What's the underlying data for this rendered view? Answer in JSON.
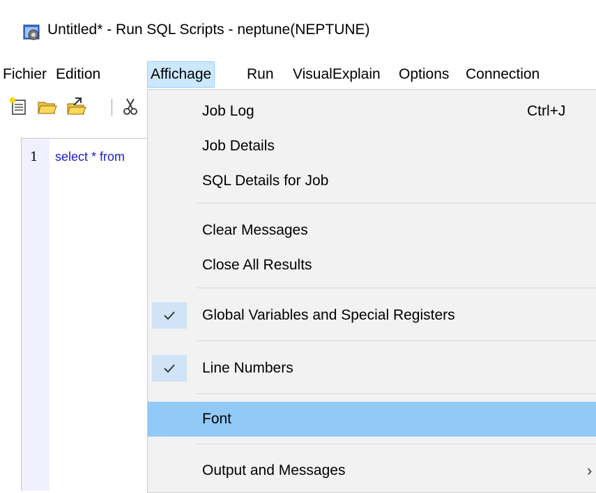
{
  "window": {
    "title": "Untitled* - Run SQL Scripts - neptune(NEPTUNE)",
    "icon": "run-sql-app-icon"
  },
  "menubar": {
    "items": [
      {
        "label": "Fichier"
      },
      {
        "label": "Edition"
      },
      {
        "label": "Affichage",
        "active": true
      },
      {
        "label": "Run"
      },
      {
        "label": "VisualExplain"
      },
      {
        "label": "Options"
      },
      {
        "label": "Connection"
      }
    ]
  },
  "toolbar": {
    "icons": [
      "new-file-icon",
      "open-folder-icon",
      "open-script-icon",
      "cut-icon"
    ]
  },
  "editor": {
    "line_number": "1",
    "code": "select * from"
  },
  "dropdown": {
    "items": [
      {
        "label": "Job Log",
        "shortcut": "Ctrl+J"
      },
      {
        "label": "Job Details",
        "shortcut": ""
      },
      {
        "label": "SQL Details for Job",
        "shortcut": ""
      },
      {
        "label": "Clear Messages",
        "shortcut": ""
      },
      {
        "label": "Close All Results",
        "shortcut": ""
      },
      {
        "label": "Global Variables and Special Registers",
        "checked": true
      },
      {
        "label": "Line Numbers",
        "checked": true
      },
      {
        "label": "Font",
        "highlighted": true
      },
      {
        "label": "Output and Messages",
        "submenu": true
      }
    ],
    "submenu_arrow": "›"
  },
  "colors": {
    "menu_active_bg": "#cce8ff",
    "item_highlight_bg": "#91c9f7",
    "code_text": "#1d1dc8",
    "check_bg": "#d0e3f7"
  }
}
